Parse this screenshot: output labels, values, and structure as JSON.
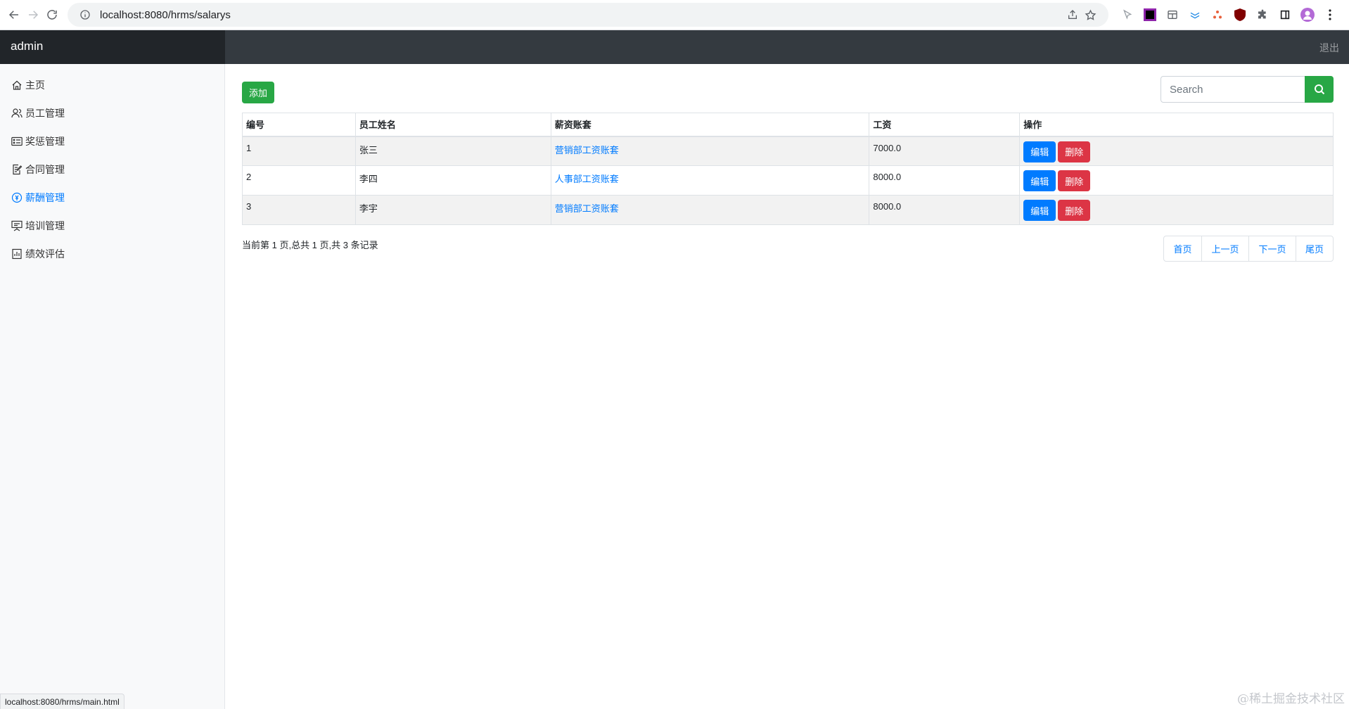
{
  "browser": {
    "url": "localhost:8080/hrms/salarys"
  },
  "navbar": {
    "brand": "admin",
    "logout": "退出"
  },
  "sidebar": {
    "items": [
      {
        "label": "主页",
        "icon": "home-icon",
        "active": false
      },
      {
        "label": "员工管理",
        "icon": "people-icon",
        "active": false
      },
      {
        "label": "奖惩管理",
        "icon": "card-list-icon",
        "active": false
      },
      {
        "label": "合同管理",
        "icon": "document-edit-icon",
        "active": false
      },
      {
        "label": "薪酬管理",
        "icon": "coin-icon",
        "active": true
      },
      {
        "label": "培训管理",
        "icon": "easel-icon",
        "active": false
      },
      {
        "label": "绩效评估",
        "icon": "clipboard-data-icon",
        "active": false
      }
    ]
  },
  "toolbar": {
    "add_label": "添加",
    "search_placeholder": "Search"
  },
  "table": {
    "headers": [
      "编号",
      "员工姓名",
      "薪资账套",
      "工资",
      "操作"
    ],
    "rows": [
      {
        "id": "1",
        "name": "张三",
        "account": "营销部工资账套",
        "salary": "7000.0"
      },
      {
        "id": "2",
        "name": "李四",
        "account": "人事部工资账套",
        "salary": "8000.0"
      },
      {
        "id": "3",
        "name": "李宇",
        "account": "营销部工资账套",
        "salary": "8000.0"
      }
    ],
    "edit_label": "编辑",
    "delete_label": "删除"
  },
  "pagination": {
    "info": "当前第 1 页,总共 1 页,共 3 条记录",
    "first": "首页",
    "prev": "上一页",
    "next": "下一页",
    "last": "尾页"
  },
  "status_bar": "localhost:8080/hrms/main.html",
  "watermark": "@稀土掘金技术社区",
  "colors": {
    "success": "#28a745",
    "primary": "#007bff",
    "danger": "#dc3545",
    "navbar": "#343a40"
  }
}
